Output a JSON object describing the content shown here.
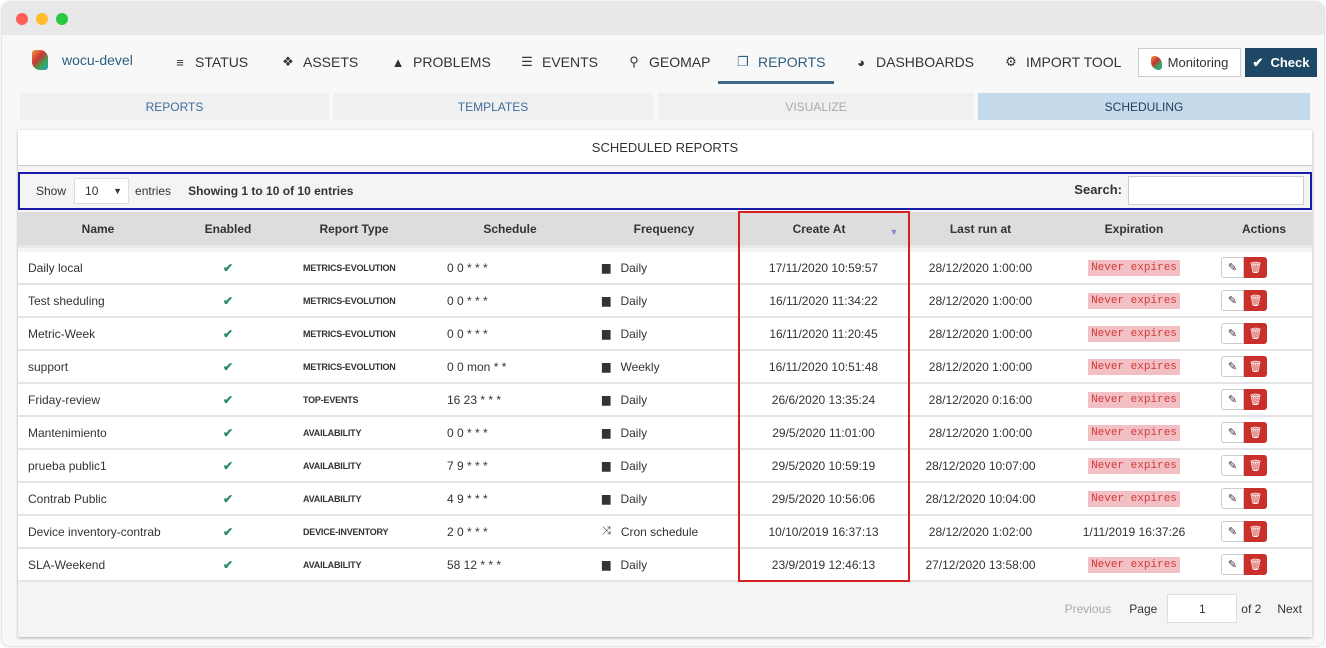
{
  "brand": "wocu-devel",
  "nav": [
    {
      "label": "STATUS",
      "icon": "list-icon",
      "glyph": "≡"
    },
    {
      "label": "ASSETS",
      "icon": "cubes-icon",
      "glyph": "❖"
    },
    {
      "label": "PROBLEMS",
      "icon": "warning-icon",
      "glyph": "▲"
    },
    {
      "label": "EVENTS",
      "icon": "database-icon",
      "glyph": "☰"
    },
    {
      "label": "GEOMAP",
      "icon": "map-marker-icon",
      "glyph": "⚲"
    },
    {
      "label": "REPORTS",
      "icon": "copy-icon",
      "glyph": "❐"
    },
    {
      "label": "DASHBOARDS",
      "icon": "dashboard-icon",
      "glyph": "◕"
    },
    {
      "label": "IMPORT TOOL",
      "icon": "gear-icon",
      "glyph": "⚙"
    }
  ],
  "monitoring_label": "Monitoring",
  "check_label": "Check",
  "subtabs": [
    "REPORTS",
    "TEMPLATES",
    "VISUALIZE",
    "SCHEDULING"
  ],
  "panel_title": "SCHEDULED REPORTS",
  "toolbar": {
    "show": "Show",
    "page_size": "10",
    "entries": "entries",
    "info": "Showing 1 to 10 of 10 entries",
    "search_label": "Search:",
    "search_value": ""
  },
  "columns": [
    "Name",
    "Enabled",
    "Report Type",
    "Schedule",
    "Frequency",
    "Create At",
    "Last run at",
    "Expiration",
    "Actions"
  ],
  "sorted_column": "Create At",
  "rows": [
    {
      "name": "Daily local",
      "type": "METRICS-EVOLUTION",
      "schedule": "0 0 * * *",
      "freq": "Daily",
      "created": "17/11/2020 10:59:57",
      "last": "28/12/2020 1:00:00",
      "exp": "Never expires"
    },
    {
      "name": "Test sheduling",
      "type": "METRICS-EVOLUTION",
      "schedule": "0 0 * * *",
      "freq": "Daily",
      "created": "16/11/2020 11:34:22",
      "last": "28/12/2020 1:00:00",
      "exp": "Never expires"
    },
    {
      "name": "Metric-Week",
      "type": "METRICS-EVOLUTION",
      "schedule": "0 0 * * *",
      "freq": "Daily",
      "created": "16/11/2020 11:20:45",
      "last": "28/12/2020 1:00:00",
      "exp": "Never expires"
    },
    {
      "name": "support",
      "type": "METRICS-EVOLUTION",
      "schedule": "0 0 mon * *",
      "freq": "Weekly",
      "created": "16/11/2020 10:51:48",
      "last": "28/12/2020 1:00:00",
      "exp": "Never expires"
    },
    {
      "name": "Friday-review",
      "type": "TOP-EVENTS",
      "schedule": "16 23 * * *",
      "freq": "Daily",
      "created": "26/6/2020 13:35:24",
      "last": "28/12/2020 0:16:00",
      "exp": "Never expires"
    },
    {
      "name": "Mantenimiento",
      "type": "AVAILABILITY",
      "schedule": "0 0 * * *",
      "freq": "Daily",
      "created": "29/5/2020 11:01:00",
      "last": "28/12/2020 1:00:00",
      "exp": "Never expires"
    },
    {
      "name": "prueba public1",
      "type": "AVAILABILITY",
      "schedule": "7 9 * * *",
      "freq": "Daily",
      "created": "29/5/2020 10:59:19",
      "last": "28/12/2020 10:07:00",
      "exp": "Never expires"
    },
    {
      "name": "Contrab Public",
      "type": "AVAILABILITY",
      "schedule": "4 9 * * *",
      "freq": "Daily",
      "created": "29/5/2020 10:56:06",
      "last": "28/12/2020 10:04:00",
      "exp": "Never expires"
    },
    {
      "name": "Device inventory-contrab",
      "type": "DEVICE-INVENTORY",
      "schedule": "2 0 * * *",
      "freq": "Cron schedule",
      "created": "10/10/2019 16:37:13",
      "last": "28/12/2020 1:02:00",
      "exp": "1/11/2019 16:37:26"
    },
    {
      "name": "SLA-Weekend",
      "type": "AVAILABILITY",
      "schedule": "58 12 * * *",
      "freq": "Daily",
      "created": "23/9/2019 12:46:13",
      "last": "27/12/2020 13:58:00",
      "exp": "Never expires"
    }
  ],
  "pager": {
    "previous": "Previous",
    "page": "Page",
    "current": "1",
    "of": "of 2",
    "next": "Next"
  },
  "colors": {
    "accent": "#1f4866",
    "danger": "#c9302c",
    "check": "#2b8a6e",
    "active_subtab": "#c5dbec"
  }
}
